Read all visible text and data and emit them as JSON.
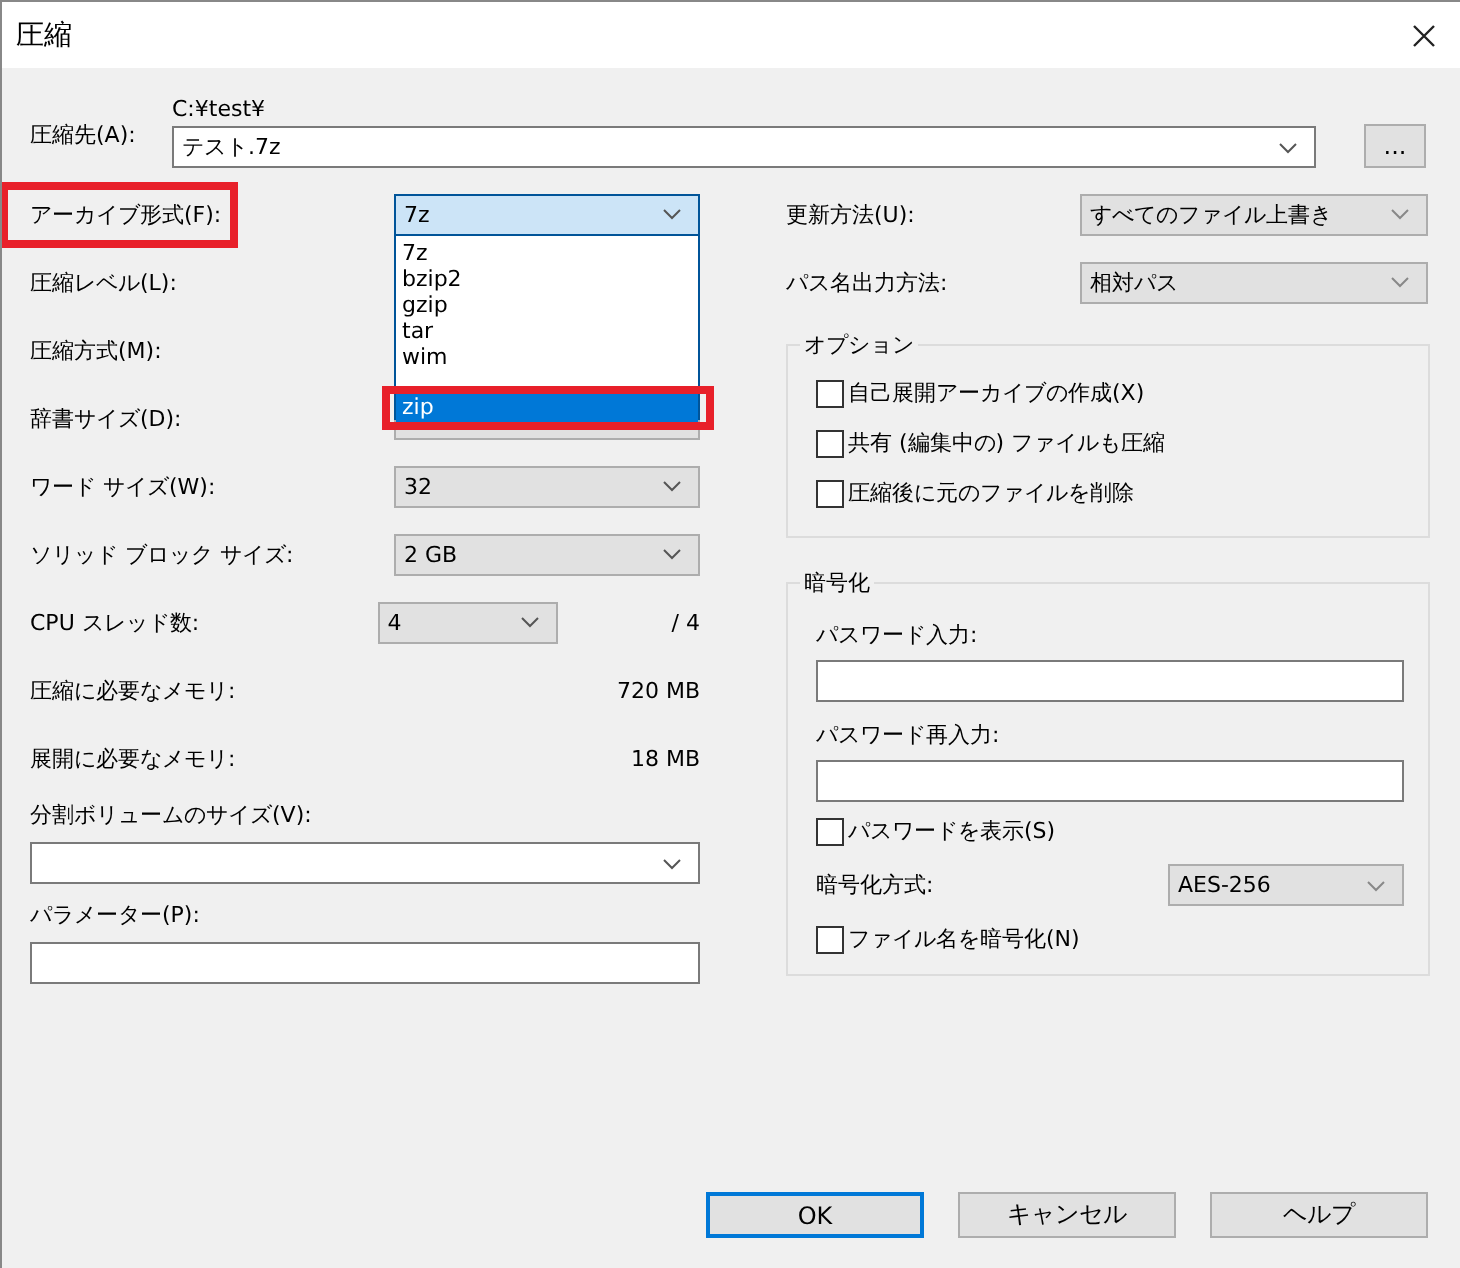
{
  "window": {
    "title": "圧縮"
  },
  "destination": {
    "label": "圧縮先(A):",
    "folder": "C:¥test¥",
    "value": "テスト.7z",
    "browse_button": "..."
  },
  "left_fields": [
    {
      "kind": "select",
      "label": "アーカイブ形式(F):",
      "value": "7z",
      "highlighted": true,
      "open": true
    },
    {
      "kind": "select",
      "label": "圧縮レベル(L):"
    },
    {
      "kind": "select",
      "label": "圧縮方式(M):"
    },
    {
      "kind": "select",
      "label": "辞書サイズ(D):"
    },
    {
      "kind": "select",
      "label": "ワード サイズ(W):",
      "value": "32"
    },
    {
      "kind": "select",
      "label": "ソリッド ブロック サイズ:",
      "value": "2 GB"
    },
    {
      "kind": "short_select",
      "label": "CPU スレッド数:",
      "value": "4",
      "suffix": "/ 4"
    },
    {
      "kind": "info",
      "label": "圧縮に必要なメモリ:",
      "value": "720 MB"
    },
    {
      "kind": "info",
      "label": "展開に必要なメモリ:",
      "value": "18 MB"
    },
    {
      "kind": "stacked_select",
      "label": "分割ボリュームのサイズ(V):"
    },
    {
      "kind": "stacked_input",
      "label": "パラメーター(P):"
    }
  ],
  "format_list": [
    {
      "label": "7z",
      "selected": false,
      "highlighted": false
    },
    {
      "label": "bzip2",
      "selected": false,
      "highlighted": false
    },
    {
      "label": "gzip",
      "selected": false,
      "highlighted": false
    },
    {
      "label": "tar",
      "selected": false,
      "highlighted": false
    },
    {
      "label": "wim",
      "selected": false,
      "highlighted": false
    },
    {
      "label": "zip",
      "selected": true,
      "highlighted": true
    }
  ],
  "right_fields": [
    {
      "label": "更新方法(U):",
      "value": "すべてのファイル上書き"
    },
    {
      "label": "パス名出力方法:",
      "value": "相対パス"
    }
  ],
  "options": {
    "title": "オプション",
    "checkboxes": [
      {
        "label": "自己展開アーカイブの作成(X)",
        "checked": false
      },
      {
        "label": "共有 (編集中の) ファイルも圧縮",
        "checked": false
      },
      {
        "label": "圧縮後に元のファイルを削除",
        "checked": false
      }
    ]
  },
  "encryption": {
    "title": "暗号化",
    "password_label": "パスワード入力:",
    "reenter_label": "パスワード再入力:",
    "show_password": {
      "label": "パスワードを表示(S)",
      "checked": false
    },
    "method_label": "暗号化方式:",
    "method_value": "AES-256",
    "encrypt_names": {
      "label": "ファイル名を暗号化(N)",
      "checked": false
    }
  },
  "buttons": [
    {
      "label": "OK",
      "default": true
    },
    {
      "label": "キャンセル",
      "default": false
    },
    {
      "label": "ヘルプ",
      "default": false
    }
  ]
}
